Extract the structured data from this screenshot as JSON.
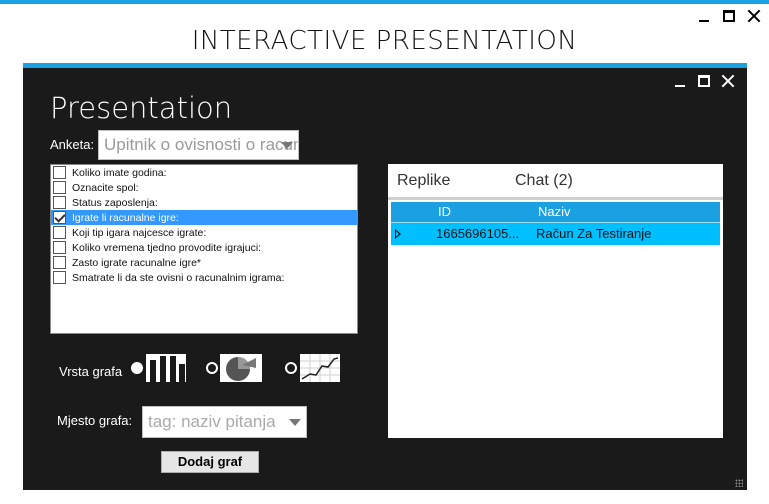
{
  "window": {
    "title": "INTERACTIVE PRESENTATION"
  },
  "inner_window": {
    "title": "Presentation"
  },
  "survey": {
    "label": "Anketa:",
    "selected": "Upitnik o ovisnosti o racunalnim igrama"
  },
  "questions": [
    {
      "label": "Koliko imate godina:",
      "checked": false,
      "selected": false
    },
    {
      "label": "Oznacite spol:",
      "checked": false,
      "selected": false
    },
    {
      "label": "Status zaposlenja:",
      "checked": false,
      "selected": false
    },
    {
      "label": "Igrate li racunalne igre:",
      "checked": true,
      "selected": true
    },
    {
      "label": "Koji tip igara najcesce igrate:",
      "checked": false,
      "selected": false
    },
    {
      "label": "Koliko vremena tjedno provodite igrajuci:",
      "checked": false,
      "selected": false
    },
    {
      "label": "Zasto igrate racunalne igre*",
      "checked": false,
      "selected": false
    },
    {
      "label": "Smatrate li da ste ovisni o racunalnim igrama:",
      "checked": false,
      "selected": false
    }
  ],
  "chart_type": {
    "label": "Vrsta grafa",
    "options": [
      {
        "icon": "bar-chart-icon",
        "selected": true
      },
      {
        "icon": "pie-chart-icon",
        "selected": false
      },
      {
        "icon": "line-chart-icon",
        "selected": false
      }
    ]
  },
  "chart_position": {
    "label": "Mjesto grafa:",
    "placeholder": "tag: naziv pitanja"
  },
  "add_button": {
    "label": "Dodaj graf"
  },
  "tabs": [
    {
      "label": "Replike",
      "active": true
    },
    {
      "label": "Chat (2)",
      "active": false
    }
  ],
  "grid": {
    "columns": [
      "ID",
      "Naziv"
    ],
    "rows": [
      {
        "id": "1665696105...",
        "naziv": "Račun Za Testiranje"
      }
    ]
  },
  "colors": {
    "accent": "#1ba1e2",
    "row_selected": "#00bfff",
    "dark_background": "#1a1a1a"
  }
}
